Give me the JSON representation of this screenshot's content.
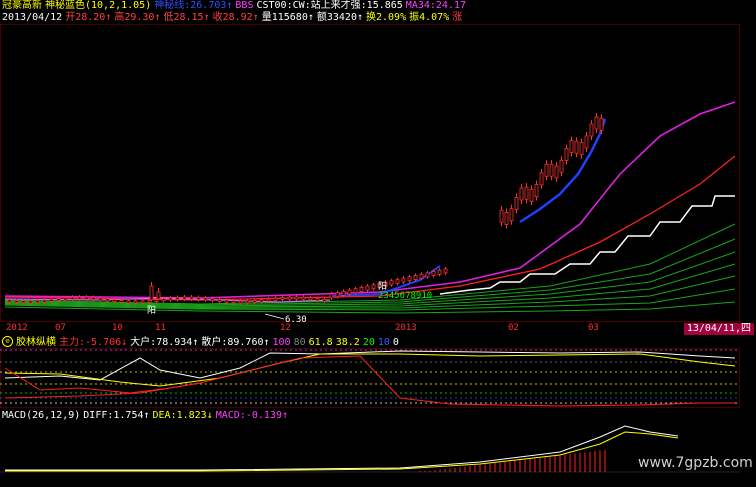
{
  "header1": [
    {
      "text": "冠豪高新",
      "color": "#ffff00"
    },
    {
      "text": "神秘蓝色(10,2,1.05)",
      "color": "#ffff00"
    },
    {
      "text": "神秘线:26.703↑",
      "color": "#3050ff"
    },
    {
      "text": "BBS",
      "color": "#ff40ff"
    },
    {
      "text": "CST00:CW:站上来才强:15.865",
      "color": "#ffffff"
    },
    {
      "text": "MA34:24.17",
      "color": "#ff40ff"
    }
  ],
  "header2": [
    {
      "text": "2013/04/12",
      "color": "#ffffff"
    },
    {
      "text": "开28.20↑",
      "color": "#ff4040"
    },
    {
      "text": "高29.30↑",
      "color": "#ff4040"
    },
    {
      "text": "低28.15↑",
      "color": "#ff4040"
    },
    {
      "text": "收28.92↑",
      "color": "#ff4040"
    },
    {
      "text": "量115680↑",
      "color": "#ffffff"
    },
    {
      "text": "额33420↑",
      "color": "#ffffff"
    },
    {
      "text": "换2.09%",
      "color": "#ffff00"
    },
    {
      "text": "振4.07%",
      "color": "#ffff00"
    },
    {
      "text": "涨",
      "color": "#ff4040"
    }
  ],
  "annotations": {
    "low_price": "6.30",
    "sequence_label": "2345678910",
    "marker1": "阳",
    "marker2": "阳"
  },
  "date_axis": [
    {
      "label": "2012",
      "pos": 6
    },
    {
      "label": "07",
      "pos": 55
    },
    {
      "label": "10",
      "pos": 112
    },
    {
      "label": "11",
      "pos": 155
    },
    {
      "label": "12",
      "pos": 280
    },
    {
      "label": "2013",
      "pos": 395
    },
    {
      "label": "02",
      "pos": 508
    },
    {
      "label": "03",
      "pos": 588
    }
  ],
  "date_hover": "13/04/11,四",
  "indicator": {
    "icon": "zoom-icon",
    "name": "胶林纵横",
    "items": [
      {
        "text": "主力:-5.706↓",
        "color": "#ff3030"
      },
      {
        "text": "大户:78.934↑",
        "color": "#ffffff"
      },
      {
        "text": "散户:89.760↑",
        "color": "#ffffff"
      },
      {
        "text": "100",
        "color": "#ff40ff"
      },
      {
        "text": "80",
        "color": "#808080"
      },
      {
        "text": "61.8",
        "color": "#ffff00"
      },
      {
        "text": "38.2",
        "color": "#ffff00"
      },
      {
        "text": "20",
        "color": "#00ff00"
      },
      {
        "text": "10",
        "color": "#3060ff"
      },
      {
        "text": "0",
        "color": "#ffffff"
      }
    ]
  },
  "macd": {
    "items": [
      {
        "text": "MACD(26,12,9)",
        "color": "#ffffff"
      },
      {
        "text": "DIFF:1.754↑",
        "color": "#ffffff"
      },
      {
        "text": "DEA:1.823↓",
        "color": "#ffff00"
      },
      {
        "text": "MACD:-0.139↑",
        "color": "#ff40ff"
      }
    ]
  },
  "watermark": "www.7gpzb.com",
  "colors": {
    "up": "#ff3030",
    "down": "#00ffff",
    "ma_magenta": "#e020e0",
    "ma_red": "#ff2020",
    "step_line": "#ffffff",
    "green_ribbon": "#20c020",
    "blue_line": "#2040ff"
  }
}
